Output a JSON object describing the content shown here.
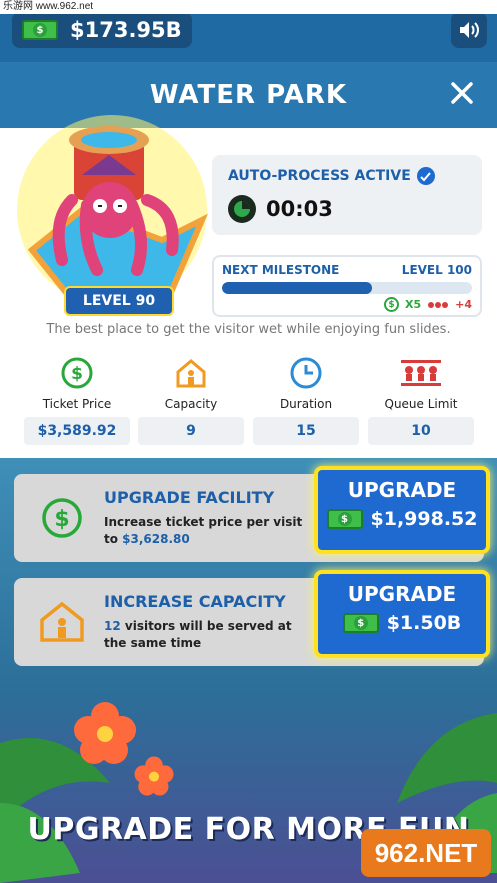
{
  "watermark_top": "乐游网 www.962.net",
  "wallet": {
    "amount": "$173.95B",
    "cash_icon": "cash-icon"
  },
  "header": {
    "title": "WATER PARK"
  },
  "building": {
    "level": "LEVEL 90"
  },
  "auto_process": {
    "title": "AUTO-PROCESS ACTIVE",
    "timer": "00:03"
  },
  "milestone": {
    "label": "NEXT MILESTONE",
    "target": "LEVEL 100",
    "progress": 0.6,
    "reward_cash": "X5",
    "reward_queue": "+4"
  },
  "description": "The best place to get the visitor wet while enjoying fun slides.",
  "stats": [
    {
      "label": "Ticket Price",
      "value": "$3,589.92",
      "icon": "dollar-icon"
    },
    {
      "label": "Capacity",
      "value": "9",
      "icon": "house-person-icon"
    },
    {
      "label": "Duration",
      "value": "15",
      "icon": "clock-icon"
    },
    {
      "label": "Queue Limit",
      "value": "10",
      "icon": "queue-icon"
    }
  ],
  "upgrades": [
    {
      "title": "UPGRADE FACILITY",
      "text_pre": "Increase ticket price per visit to ",
      "highlight": "$3,628.80",
      "text_post": "",
      "button_label": "UPGRADE",
      "price": "$1,998.52"
    },
    {
      "title": "INCREASE CAPACITY",
      "text_pre": "",
      "highlight": "12",
      "text_post": " visitors will be served at the same time",
      "button_label": "UPGRADE",
      "price": "$1.50B"
    }
  ],
  "cta": "UPGRADE FOR MORE FUN",
  "watermark_logo": "962.NET",
  "colors": {
    "accent": "#1f6ad0",
    "highlight": "#ffe11f",
    "green": "#29a83a",
    "red": "#d93b3b"
  }
}
